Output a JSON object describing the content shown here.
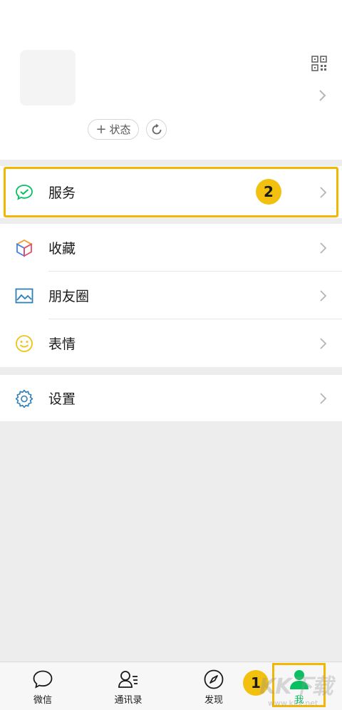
{
  "profile": {
    "status_label": "状态",
    "status_plus": "+"
  },
  "menu": {
    "service": {
      "label": "服务",
      "icon": "wechat-pay-icon"
    },
    "favorites": {
      "label": "收藏",
      "icon": "favorites-cube-icon"
    },
    "moments": {
      "label": "朋友圈",
      "icon": "image-icon"
    },
    "stickers": {
      "label": "表情",
      "icon": "smiley-icon"
    },
    "settings": {
      "label": "设置",
      "icon": "gear-icon"
    }
  },
  "annotations": {
    "step1": "1",
    "step2": "2",
    "highlight_color": "#f2b705",
    "badge_color": "#f2c10f"
  },
  "tabbar": {
    "tabs": [
      {
        "label": "微信",
        "icon": "chat-bubble-icon"
      },
      {
        "label": "通讯录",
        "icon": "contacts-icon"
      },
      {
        "label": "发现",
        "icon": "compass-icon"
      },
      {
        "label": "我",
        "icon": "person-icon",
        "active": true
      }
    ],
    "active_color": "#07c160"
  },
  "watermark": {
    "text": "KK下载",
    "sub": "www.kkx.net"
  }
}
